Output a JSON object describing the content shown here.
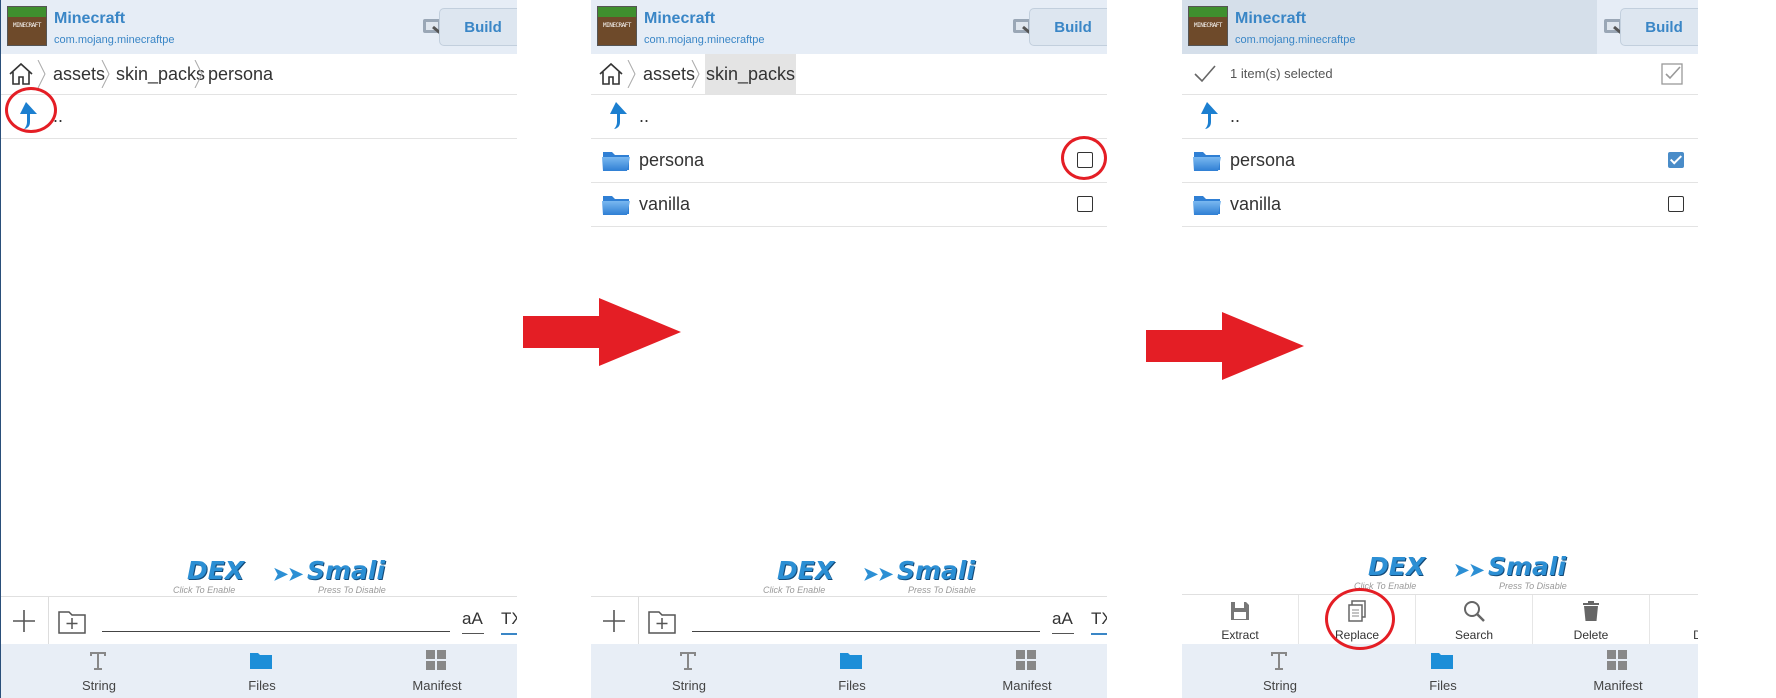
{
  "app": {
    "name": "Minecraft",
    "package": "com.mojang.minecraftpe",
    "icon_text": "MINECRAFT",
    "build_label": "Build"
  },
  "panel1": {
    "breadcrumb": [
      "assets",
      "skin_packs",
      "persona"
    ],
    "rows": [
      {
        "name": "..",
        "type": "parent"
      }
    ]
  },
  "panel2": {
    "breadcrumb": [
      "assets",
      "skin_packs"
    ],
    "rows": [
      {
        "name": "..",
        "type": "parent"
      },
      {
        "name": "persona",
        "type": "folder",
        "checked": false
      },
      {
        "name": "vanilla",
        "type": "folder",
        "checked": false
      }
    ]
  },
  "panel3": {
    "selection_text": "1 item(s) selected",
    "rows": [
      {
        "name": "..",
        "type": "parent"
      },
      {
        "name": "persona",
        "type": "folder",
        "checked": true
      },
      {
        "name": "vanilla",
        "type": "folder",
        "checked": false
      }
    ],
    "actions": [
      {
        "label": "Extract",
        "icon": "save-icon"
      },
      {
        "label": "Replace",
        "icon": "copy-icon"
      },
      {
        "label": "Search",
        "icon": "search-icon"
      },
      {
        "label": "Delete",
        "icon": "trash-icon"
      },
      {
        "label": "Detail",
        "icon": "list-icon"
      }
    ]
  },
  "dex_banner": {
    "left": "DEX",
    "right": "Smali",
    "left_hint": "Click To Enable",
    "right_hint": "Press To Disable"
  },
  "input_bar": {
    "case_label": "aA",
    "txt_label": "TXT"
  },
  "nav": {
    "tabs": [
      {
        "label": "String",
        "icon": "string-icon"
      },
      {
        "label": "Files",
        "icon": "folder-icon"
      },
      {
        "label": "Manifest",
        "icon": "grid-icon"
      }
    ]
  },
  "colors": {
    "accent": "#3a86c6",
    "annotation": "#e41e25",
    "header_bg": "#e6edf6"
  }
}
